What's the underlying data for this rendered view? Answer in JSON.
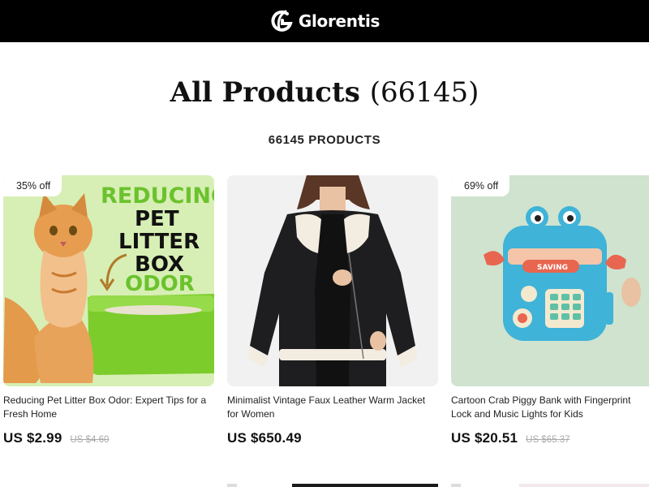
{
  "header": {
    "brand_name": "Glorentis"
  },
  "page": {
    "title": "All Products",
    "title_count": "(66145)",
    "products_count_text": "66145 PRODUCTS"
  },
  "products": [
    {
      "badge": "35% off",
      "image_text": [
        "REDUCING",
        "PET",
        "LITTER",
        "BOX",
        "ODOR"
      ],
      "title": "Reducing Pet Litter Box Odor: Expert Tips for a Fresh Home",
      "price": "US $2.99",
      "old_price": "US $4.60"
    },
    {
      "badge": "",
      "title": "Minimalist Vintage Faux Leather Warm Jacket for Women",
      "price": "US $650.49",
      "old_price": ""
    },
    {
      "badge": "69% off",
      "image_text": [
        "SAVING"
      ],
      "title": "Cartoon Crab Piggy Bank with Fingerprint Lock and Music Lights for Kids",
      "price": "US $20.51",
      "old_price": "US $65.37"
    }
  ],
  "colors": {
    "header_bg": "#000000",
    "litter_green": "#7ccc2c",
    "lime_bg": "#d7efb5",
    "mint_bg": "#cfe3cf",
    "crab_blue": "#3fb3d8"
  },
  "icons": {
    "brand": "glorentis-logo-icon"
  }
}
